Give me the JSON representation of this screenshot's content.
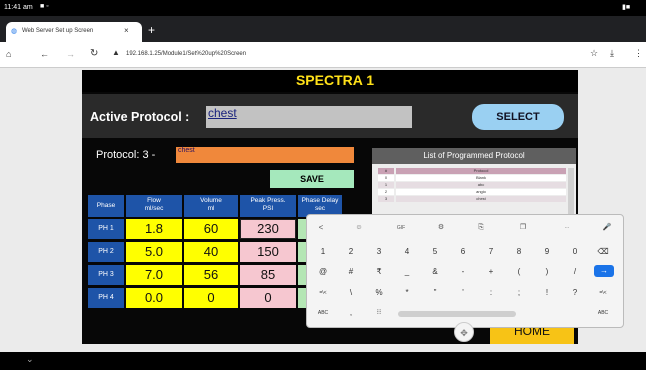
{
  "status_bar": {
    "time": "11:41 am"
  },
  "browser": {
    "tab_title": "Web Server Set up Screen",
    "tab_close": "×",
    "new_tab": "+",
    "url": "192.168.1.25/Module1/Set%20up%20Screen"
  },
  "app": {
    "title": "SPECTRA 1",
    "active_protocol_label": "Active Protocol :",
    "active_protocol_value": "chest",
    "select_label": "SELECT",
    "protocol_label": "Protocol: 3 -",
    "protocol_value": "chest",
    "save_label": "SAVE",
    "home_label": "HOME",
    "table": {
      "headers": [
        {
          "main": "Phase",
          "unit": ""
        },
        {
          "main": "Flow",
          "unit": "ml/sec"
        },
        {
          "main": "Volume",
          "unit": "ml"
        },
        {
          "main": "Peak Press.",
          "unit": "PSI"
        },
        {
          "main": "Phase Delay",
          "unit": "sec"
        }
      ],
      "rows": [
        {
          "phase": "PH 1",
          "flow": "1.8",
          "volume": "60",
          "pressure": "230"
        },
        {
          "phase": "PH 2",
          "flow": "5.0",
          "volume": "40",
          "pressure": "150"
        },
        {
          "phase": "PH 3",
          "flow": "7.0",
          "volume": "56",
          "pressure": "85"
        },
        {
          "phase": "PH 4",
          "flow": "0.0",
          "volume": "0",
          "pressure": "0"
        }
      ]
    },
    "list": {
      "title": "List of Programmed Protocol",
      "column": "Protocol",
      "rows": [
        {
          "num": "0",
          "name": "Blank"
        },
        {
          "num": "1",
          "name": "abc"
        },
        {
          "num": "2",
          "name": "angio"
        },
        {
          "num": "3",
          "name": "chest"
        }
      ]
    }
  },
  "keyboard": {
    "toolbar": [
      "<",
      "☺",
      "GIF",
      "⚙",
      "⎘",
      "❐",
      "···",
      "🎤"
    ],
    "row1": [
      "1",
      "2",
      "3",
      "4",
      "5",
      "6",
      "7",
      "8",
      "9",
      "0",
      "⌫"
    ],
    "row2": [
      "@",
      "#",
      "₹",
      "_",
      "&",
      "-",
      "+",
      "(",
      ")",
      "/",
      "→"
    ],
    "row3": [
      "=\\<",
      "\\",
      "%",
      "*",
      "\"",
      "'",
      ":",
      ";",
      "!",
      "?",
      "=\\<"
    ],
    "row4_left": "ABC",
    "row4_comma": ",",
    "row4_right": "ABC"
  }
}
